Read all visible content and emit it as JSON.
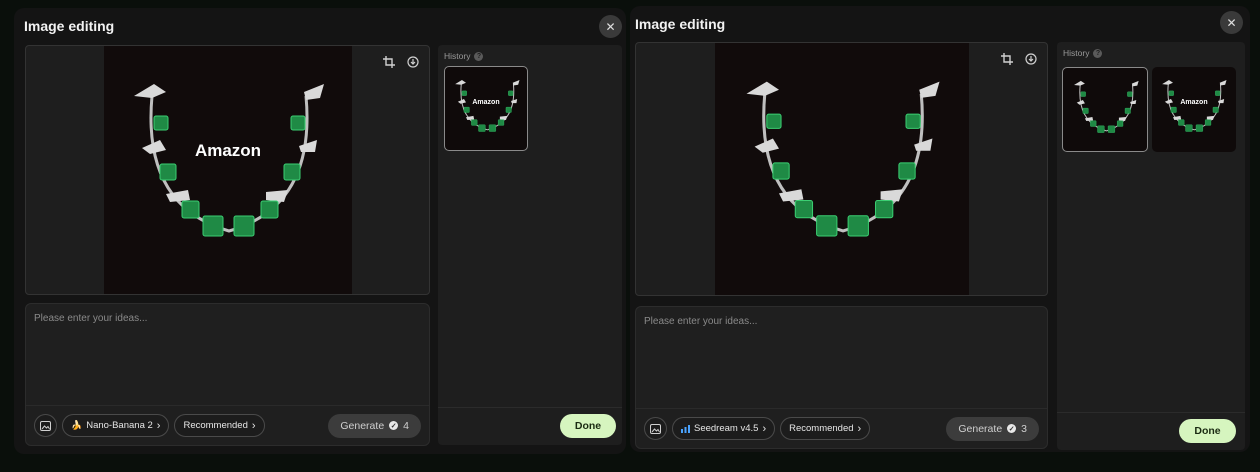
{
  "panels": [
    {
      "title": "Image editing",
      "brand_watermark": "Amazon",
      "prompt_placeholder": "Please enter your ideas...",
      "model_label": "Nano-Banana 2",
      "model_icon": "banana-icon",
      "recommended_label": "Recommended",
      "generate_label": "Generate",
      "generate_cost": "4",
      "history_label": "History",
      "history_thumbs": [
        {
          "brand": "Amazon",
          "selected": true
        }
      ],
      "done_label": "Done"
    },
    {
      "title": "Image editing",
      "prompt_placeholder": "Please enter your ideas...",
      "model_label": "Seedream v4.5",
      "model_icon": "bar-chart-icon",
      "recommended_label": "Recommended",
      "generate_label": "Generate",
      "generate_cost": "3",
      "history_label": "History",
      "history_thumbs": [
        {
          "brand": "",
          "selected": true
        },
        {
          "brand": "Amazon",
          "selected": false
        }
      ],
      "done_label": "Done"
    }
  ],
  "colors": {
    "accent_done": "#d6f5bf",
    "emerald": "#1f8a45",
    "background": "#141414"
  }
}
